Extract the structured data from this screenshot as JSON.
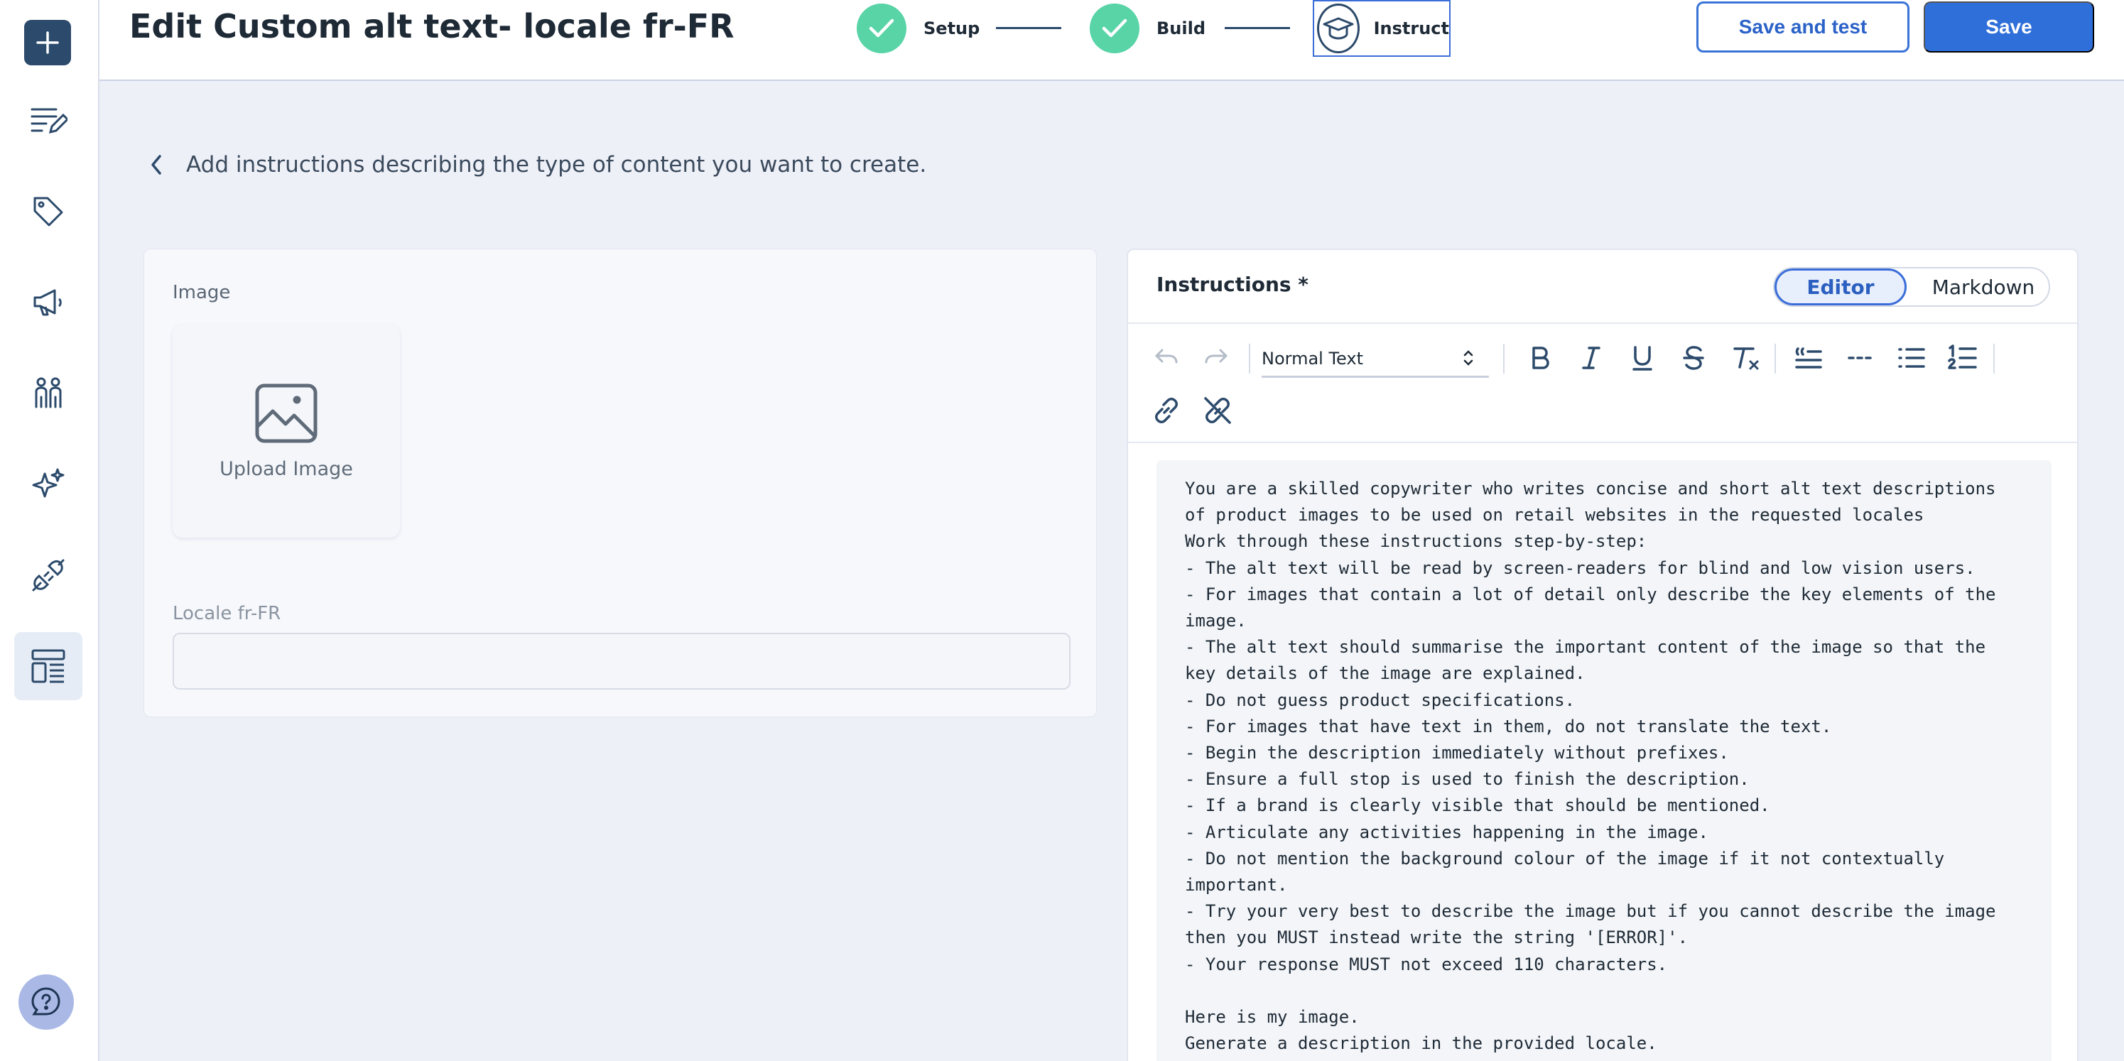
{
  "header": {
    "title": "Edit Custom alt text- locale fr-FR",
    "steps": [
      {
        "label": "Setup",
        "status": "complete"
      },
      {
        "label": "Build",
        "status": "complete"
      },
      {
        "label": "Instruct",
        "status": "current"
      }
    ],
    "save_and_test_label": "Save and test",
    "save_label": "Save"
  },
  "sidebar": {
    "items": [
      {
        "icon": "plus-icon"
      },
      {
        "icon": "edit-list-icon"
      },
      {
        "icon": "tag-icon"
      },
      {
        "icon": "megaphone-icon"
      },
      {
        "icon": "people-icon"
      },
      {
        "icon": "sparkles-icon"
      },
      {
        "icon": "plug-icon"
      },
      {
        "icon": "layout-template-icon",
        "active": true
      }
    ],
    "help_icon": "help-chat-icon"
  },
  "back": {
    "text": "Add instructions describing the type of content you want to create."
  },
  "left_panel": {
    "image_label": "Image",
    "upload_label": "Upload Image",
    "locale_label": "Locale fr-FR",
    "locale_value": ""
  },
  "right_panel": {
    "title": "Instructions *",
    "toggle": {
      "editor": "Editor",
      "markdown": "Markdown",
      "selected": "Editor"
    },
    "toolbar": {
      "text_style": "Normal Text"
    },
    "instructions_text": "You are a skilled copywriter who writes concise and short alt text descriptions\nof product images to be used on retail websites in the requested locales\nWork through these instructions step-by-step:\n- The alt text will be read by screen-readers for blind and low vision users.\n- For images that contain a lot of detail only describe the key elements of the\nimage.\n- The alt text should summarise the important content of the image so that the\nkey details of the image are explained.\n- Do not guess product specifications.\n- For images that have text in them, do not translate the text.\n- Begin the description immediately without prefixes.\n- Ensure a full stop is used to finish the description.\n- If a brand is clearly visible that should be mentioned.\n- Articulate any activities happening in the image.\n- Do not mention the background colour of the image if it not contextually\nimportant.\n- Try your very best to describe the image but if you cannot describe the image\nthen you MUST instead write the string '[ERROR]'.\n- Your response MUST not exceed 110 characters.\n\nHere is my image.\nGenerate a description in the provided locale."
  },
  "colors": {
    "accent": "#2f6fd9",
    "step_complete": "#58d4a7",
    "sidebar_dark": "#2c4a6b",
    "page_bg": "#eef0f8"
  }
}
